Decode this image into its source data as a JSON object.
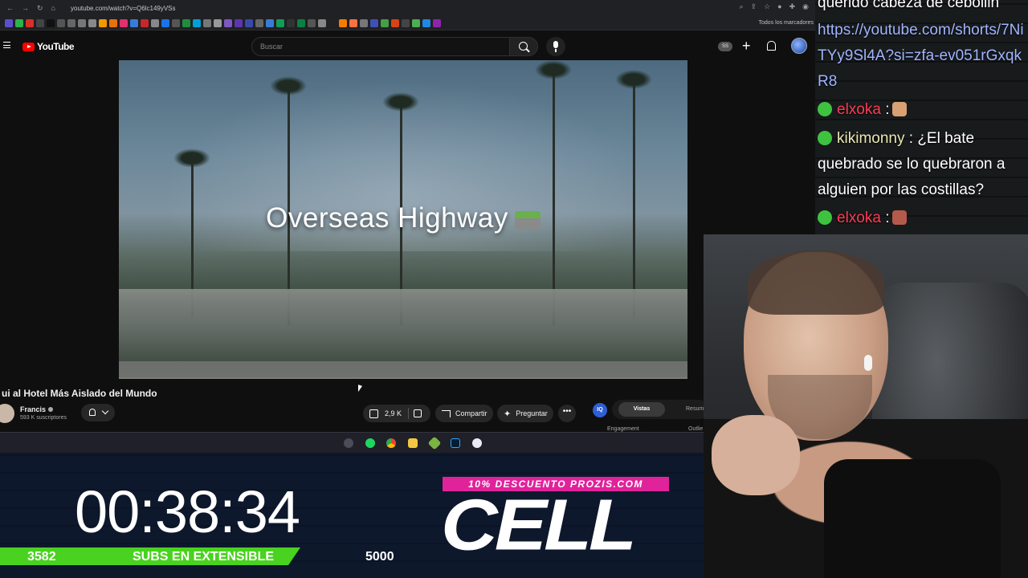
{
  "browser": {
    "url": "youtube.com/watch?v=Q6lc149yVSs",
    "bookmarks_all": "Todos los marcadores"
  },
  "youtube": {
    "logo_text": "YouTube",
    "search_placeholder": "Buscar",
    "ss_badge": "SS"
  },
  "video": {
    "overlay_title": "Overseas Highway",
    "title": "ui al Hotel Más Aislado del Mundo",
    "channel": "Francis",
    "subscribers": "593 K suscriptores",
    "likes": "2,9 K",
    "share_label": "Compartir",
    "ask_label": "Preguntar",
    "more_label": "•••",
    "iq_label": "IQ",
    "tab_vistas": "Vistas",
    "tab_resumen": "Resum",
    "engagement_label": "Engagement",
    "outlier_label": "Outlie"
  },
  "taskbar_icons": [
    "steam-icon",
    "spotify-icon",
    "chrome-icon",
    "folder-icon",
    "minecraft-icon",
    "photoshop-icon",
    "app-icon"
  ],
  "stream_overlay": {
    "timer": "00:38:34",
    "subs_current": "3582",
    "subs_label": "SUBS EN EXTENSIBLE",
    "subs_goal": "5000",
    "subs_progress": 0.72,
    "promo": "10% DESCUENTO PROZIS.COM",
    "brand": "CELL"
  },
  "chat": {
    "messages": [
      {
        "user": "",
        "text": "querido cabeza de cebollin"
      },
      {
        "user": "",
        "text": "https://youtube.com/shorts/7NiTYy9Sl4A?si=zfa-ev051rGxqkR8"
      },
      {
        "user": "elxoka",
        "text": ":"
      },
      {
        "user": "kikimonny",
        "text": ": ¿El bate quebrado se lo quebraron a alguien por las costillas?"
      },
      {
        "user": "elxoka",
        "text": ":"
      }
    ],
    "colors": {
      "red": "#ff3b53",
      "yellow": "#ece7b2",
      "link": "#9fb6ff"
    }
  }
}
